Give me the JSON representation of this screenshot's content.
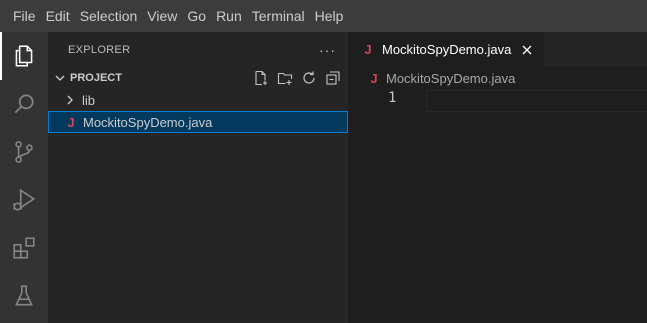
{
  "menubar": {
    "items": [
      "File",
      "Edit",
      "Selection",
      "View",
      "Go",
      "Run",
      "Terminal",
      "Help"
    ]
  },
  "activitybar": {
    "icons": [
      "explorer-icon",
      "search-icon",
      "source-control-icon",
      "run-debug-icon",
      "extensions-icon",
      "testing-icon"
    ]
  },
  "sidebar": {
    "title": "EXPLORER",
    "more": "···",
    "section": {
      "title": "PROJECT",
      "actions": [
        "new-file-icon",
        "new-folder-icon",
        "refresh-icon",
        "collapse-all-icon"
      ]
    },
    "tree": {
      "folder": "lib",
      "file": "MockitoSpyDemo.java",
      "file_icon": "J"
    }
  },
  "editor": {
    "tab": {
      "label": "MockitoSpyDemo.java",
      "icon": "J"
    },
    "breadcrumb": {
      "label": "MockitoSpyDemo.java",
      "icon": "J"
    },
    "line_number": "1"
  },
  "colors": {
    "java": "#d14359",
    "selection": "#04395e",
    "focus_border": "#007fd4"
  }
}
